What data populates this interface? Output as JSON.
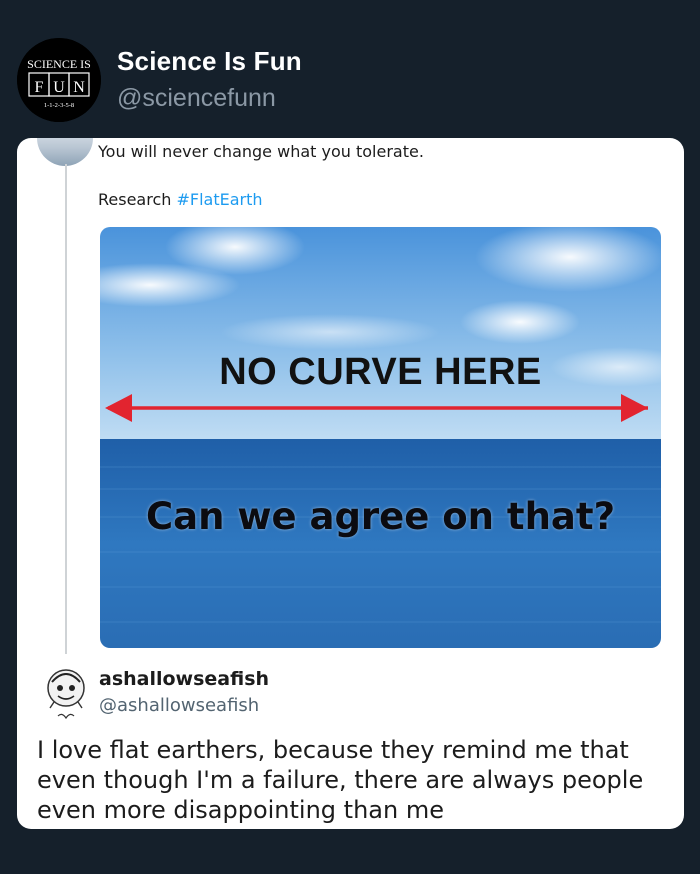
{
  "account": {
    "display_name": "Science Is Fun",
    "handle": "@sciencefunn",
    "logo_top_text": "SCIENCE IS",
    "logo_letters": [
      "F",
      "U",
      "N"
    ],
    "logo_sequence": "1-1-2-3-5-8"
  },
  "quoted_post": {
    "text": "You will never change what you tolerate.",
    "research_word": "Research",
    "hashtag": "#FlatEarth"
  },
  "meme": {
    "title": "NO CURVE HERE",
    "question": "Can we agree on that?",
    "arrow_color": "#e2242f"
  },
  "reply": {
    "name": "ashallowseafish",
    "handle": "@ashallowseafish",
    "text": "I love flat earthers, because they remind me that even though I'm a failure, there are always people even more disappointing than me"
  },
  "colors": {
    "background": "#15202b",
    "card": "#ffffff",
    "link": "#1d9bf0"
  }
}
